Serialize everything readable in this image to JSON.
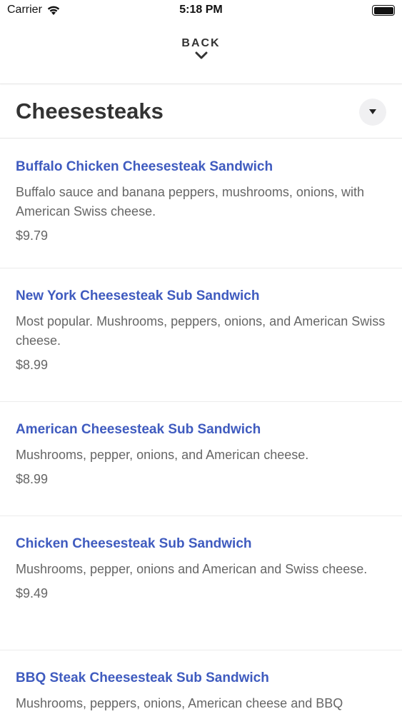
{
  "status_bar": {
    "carrier": "Carrier",
    "time": "5:18 PM"
  },
  "nav": {
    "back_label": "BACK"
  },
  "section": {
    "title": "Cheesesteaks"
  },
  "items": [
    {
      "name": "Buffalo Chicken Cheesesteak Sandwich",
      "description": "Buffalo sauce and banana peppers, mushrooms, onions, with American Swiss cheese.",
      "price": "$9.79"
    },
    {
      "name": "New York Cheesesteak Sub Sandwich",
      "description": "Most popular. Mushrooms, peppers, onions, and American Swiss cheese.",
      "price": "$8.99"
    },
    {
      "name": "American Cheesesteak Sub Sandwich",
      "description": "Mushrooms, pepper, onions, and American cheese.",
      "price": "$8.99"
    },
    {
      "name": "Chicken Cheesesteak Sub Sandwich",
      "description": "Mushrooms, pepper, onions and American and Swiss cheese.",
      "price": "$9.49"
    },
    {
      "name": "BBQ Steak Cheesesteak Sub Sandwich",
      "description": "Mushrooms, peppers, onions, American cheese and BBQ",
      "price": ""
    }
  ],
  "colors": {
    "item_name": "#3f5bbf",
    "text_secondary": "#666666",
    "title": "#333333"
  },
  "icons": {
    "wifi": "wifi-icon",
    "battery": "battery-icon",
    "back_chevron": "chevron-down-icon",
    "section_toggle": "caret-down-icon"
  }
}
